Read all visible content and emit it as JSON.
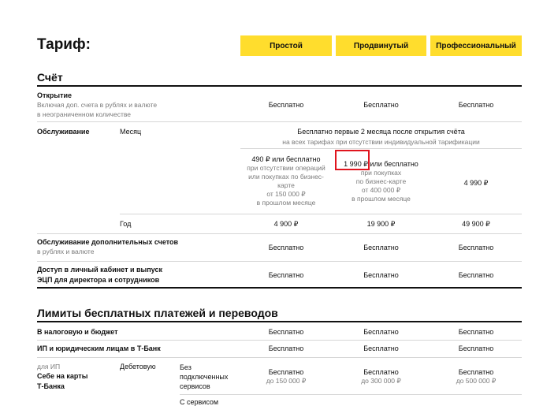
{
  "tariff_title": "Тариф:",
  "plans": [
    "Простой",
    "Продвинутый",
    "Профессиональный"
  ],
  "account": {
    "heading": "Счёт",
    "opening": {
      "label": "Открытие",
      "sub1": "Включая доп. счета в рублях и валюте",
      "sub2": "в неограниченном количестве",
      "values": [
        "Бесплатно",
        "Бесплатно",
        "Бесплатно"
      ]
    },
    "service": {
      "label": "Обслуживание",
      "month_label": "Месяц",
      "month_free": "Бесплатно первые 2 месяца после открытия счёта",
      "month_free_sub": "на всех тарифах при отсутствии индивидуальной тарификации",
      "simple": {
        "main": "490 ₽ или бесплатно",
        "l1": "при отсутствии операций",
        "l2": "или покупках по бизнес-",
        "l3": "карте",
        "l4": "от 150 000 ₽",
        "l5": "в прошлом месяце"
      },
      "advanced": {
        "main": "1 990 ₽ или бесплатно",
        "l1": "при покупках",
        "l2": "по бизнес-карте",
        "l3": "от 400 000 ₽",
        "l4": "в прошлом месяце"
      },
      "professional": "4 990 ₽",
      "year_label": "Год",
      "year_values": [
        "4 900 ₽",
        "19 900 ₽",
        "49 900 ₽"
      ]
    },
    "extra_accounts": {
      "label": "Обслуживание дополнительных счетов",
      "sub": "в рублях и валюте",
      "values": [
        "Бесплатно",
        "Бесплатно",
        "Бесплатно"
      ]
    },
    "cabinet": {
      "label1": "Доступ в личный кабинет и выпуск",
      "label2": "ЭЦП для директора и сотрудников",
      "values": [
        "Бесплатно",
        "Бесплатно",
        "Бесплатно"
      ]
    }
  },
  "limits": {
    "heading": "Лимиты бесплатных платежей и переводов",
    "tax": {
      "label": "В налоговую и бюджет",
      "values": [
        "Бесплатно",
        "Бесплатно",
        "Бесплатно"
      ]
    },
    "legal": {
      "label": "ИП и юридическим лицам в Т-Банк",
      "values": [
        "Бесплатно",
        "Бесплатно",
        "Бесплатно"
      ]
    },
    "self": {
      "for_ip": "для ИП",
      "label1": "Себе на карты",
      "label2": "Т-Банка",
      "card": "Дебетовую",
      "no_services1": "Без",
      "no_services2": "подключенных",
      "no_services3": "сервисов",
      "values": [
        "Бесплатно",
        "Бесплатно",
        "Бесплатно"
      ],
      "limits": [
        "до 150 000 ₽",
        "до 300 000 ₽",
        "до 500 000 ₽"
      ],
      "next_row": "С сервисом"
    }
  }
}
